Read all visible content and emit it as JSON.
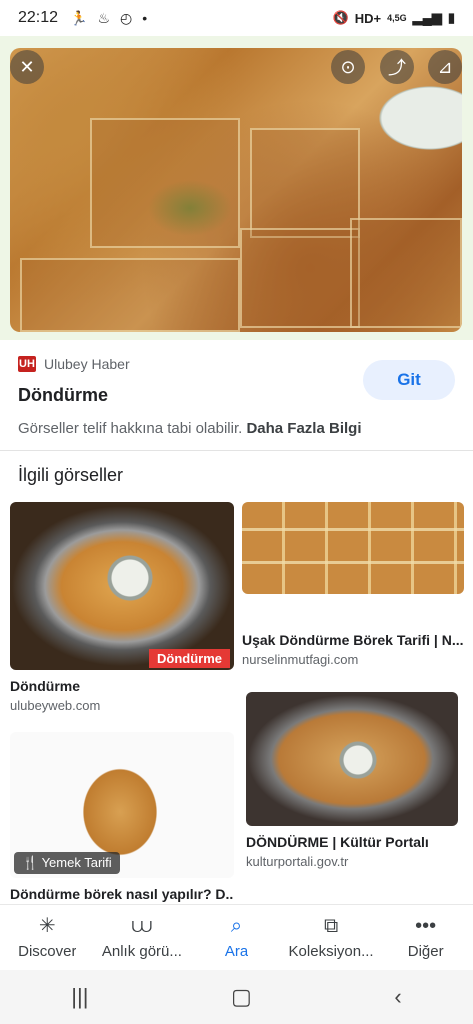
{
  "status": {
    "time": "22:12",
    "network": "HD+",
    "net_gen": "4,5G"
  },
  "viewer": {
    "source_name": "Ulubey Haber",
    "source_logo_text": "UH",
    "title": "Döndürme",
    "visit_label": "Git",
    "copyright_text": "Görseller telif hakkına tabi olabilir.",
    "more_info": "Daha Fazla Bilgi"
  },
  "related": {
    "heading": "İlgili görseller",
    "items": [
      {
        "caption": "Döndürme",
        "domain": "ulubeyweb.com",
        "badge": "Döndürme"
      },
      {
        "caption": "Uşak Döndürme Börek Tarifi | N...",
        "domain": "nurselinmutfagi.com"
      },
      {
        "caption": "Döndürme börek nasıl yapılır? D...",
        "tag": "Yemek Tarifi"
      },
      {
        "caption": "DÖNDÜRME | Kültür Portalı",
        "domain": "kulturportali.gov.tr"
      }
    ]
  },
  "bottom_nav": [
    {
      "label": "Discover",
      "icon": "asterisk-icon"
    },
    {
      "label": "Anlık görü...",
      "icon": "snapshot-icon"
    },
    {
      "label": "Ara",
      "icon": "search-icon"
    },
    {
      "label": "Koleksiyon...",
      "icon": "collections-icon"
    },
    {
      "label": "Diğer",
      "icon": "more-icon"
    }
  ],
  "colors": {
    "accent": "#1a73e8",
    "hero_bg": "#eef6e6",
    "badge_red": "#e53935"
  }
}
